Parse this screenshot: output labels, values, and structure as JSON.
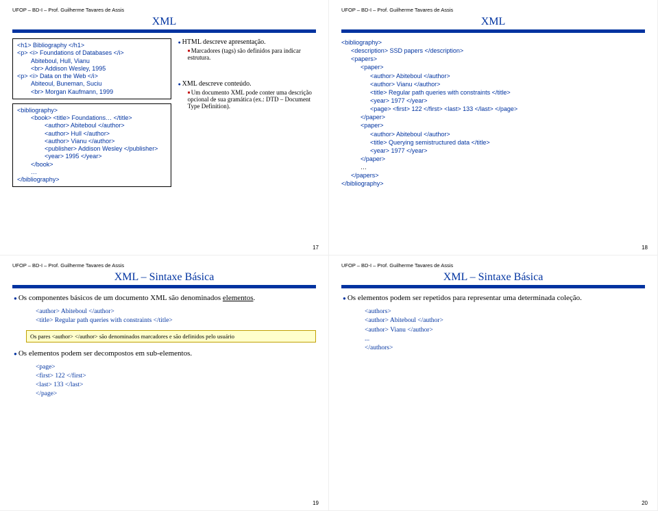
{
  "header": "UFOP – BD-I – Prof. Guilherme Tavares de Assis",
  "s17": {
    "title": "XML",
    "box1": {
      "l0a": "<h1> Bibliography </h1>",
      "l0b": "<p> <i> Foundations of Databases </i>",
      "l1a": "Abiteboul, Hull, Vianu",
      "l1b": "<br> Addison Wesley, 1995",
      "l0c": "<p> <i> Data on the Web </i>",
      "l1c": "Abiteoul, Buneman, Suciu",
      "l1d": "<br> Morgan Kaufmann, 1999"
    },
    "box2": {
      "a": "<bibliography>",
      "b": "<book> <title> Foundations… </title>",
      "c": "<author> Abiteboul </author>",
      "d": "<author> Hull </author>",
      "e": "<author> Vianu </author>",
      "f": "<publisher> Addison Wesley </publisher>",
      "g": "<year> 1995 </year>",
      "h": "</book>",
      "i": "…",
      "j": "</bibliography>"
    },
    "r1": "HTML descreve apresentação.",
    "r1a": "Marcadores (tags) são definidos para indicar estrutura.",
    "r2": "XML descreve conteúdo.",
    "r2a": "Um documento XML pode conter uma descrição opcional de sua gramática (ex.: DTD – Document Type Definition).",
    "pagenum": "17"
  },
  "s18": {
    "title": "XML",
    "code": {
      "a": "<bibliography>",
      "b": "<description> SSD papers </description>",
      "c": "<papers>",
      "d": "<paper>",
      "e": "<author> Abiteboul </author>",
      "f": "<author> Vianu </author>",
      "g": "<title> Regular path queries with constraints </title>",
      "h": "<year> 1977 </year>",
      "i": "<page> <first> 122 </first> <last> 133 </last> </page>",
      "j": "</paper>",
      "k": "<paper>",
      "l": "<author> Abiteboul </author>",
      "m": "<title> Querying semistructured data </title>",
      "n": "<year> 1977 </year>",
      "o": "</paper>",
      "p": "…",
      "q": "</papers>",
      "r": "</bibliography>"
    },
    "pagenum": "18"
  },
  "s19": {
    "title": "XML – Sintaxe Básica",
    "p1a": "Os componentes básicos de um documento XML são denominados ",
    "p1b": "elementos",
    "p1c": ".",
    "c1": "<author> Abiteboul </author>",
    "c2": "<title> Regular path queries with constraints </title>",
    "note": "Os pares <author> </author> são denominados marcadores e são definidos pelo usuário",
    "p2": "Os elementos podem ser decompostos em sub-elementos.",
    "c3": "<page>",
    "c4": "<first> 122 </first>",
    "c5": "<last> 133 </last>",
    "c6": "</page>",
    "pagenum": "19"
  },
  "s20": {
    "title": "XML – Sintaxe Básica",
    "p1": "Os elementos podem ser repetidos para representar uma determinada coleção.",
    "c1": "<authors>",
    "c2": "<author> Abiteboul </author>",
    "c3": "<author> Vianu </author>",
    "c4": "...",
    "c5": "</authors>",
    "pagenum": "20"
  }
}
